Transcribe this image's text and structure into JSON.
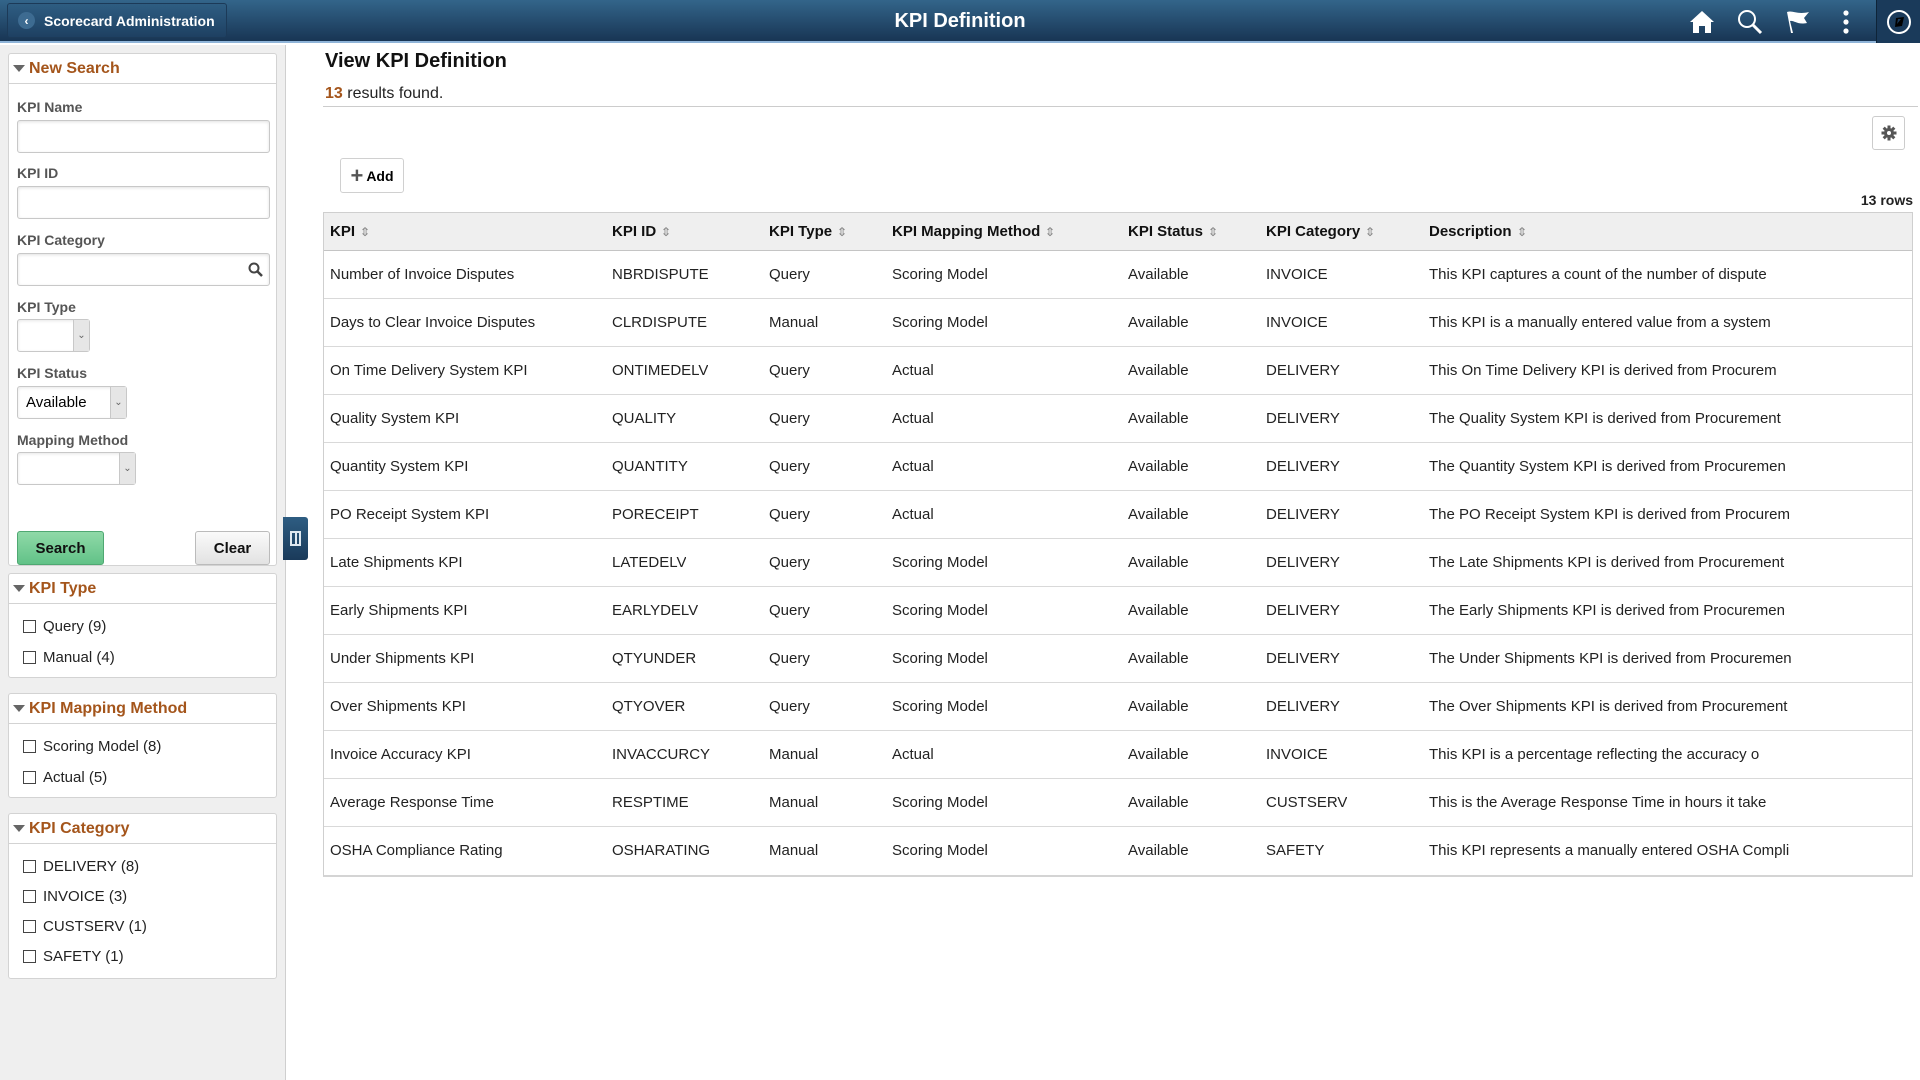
{
  "banner": {
    "back_label": "Scorecard Administration",
    "title": "KPI Definition",
    "icons": [
      "home-icon",
      "search-icon",
      "flag-icon",
      "more-options-icon",
      "navbar-compass-icon"
    ]
  },
  "sidebar": {
    "new_search": {
      "header": "New Search",
      "fields": {
        "kpi_name": {
          "label": "KPI Name",
          "value": ""
        },
        "kpi_id": {
          "label": "KPI ID",
          "value": ""
        },
        "kpi_category": {
          "label": "KPI Category",
          "value": ""
        },
        "kpi_type": {
          "label": "KPI Type",
          "value": ""
        },
        "kpi_status": {
          "label": "KPI Status",
          "value": "Available"
        },
        "mapping_method": {
          "label": "Mapping Method",
          "value": ""
        }
      },
      "search_label": "Search",
      "clear_label": "Clear"
    },
    "facets": [
      {
        "header": "KPI Type",
        "items": [
          {
            "label": "Query (9)"
          },
          {
            "label": "Manual (4)"
          }
        ]
      },
      {
        "header": "KPI Mapping Method",
        "items": [
          {
            "label": "Scoring Model (8)"
          },
          {
            "label": "Actual (5)"
          }
        ]
      },
      {
        "header": "KPI Category",
        "items": [
          {
            "label": "DELIVERY (8)"
          },
          {
            "label": "INVOICE (3)"
          },
          {
            "label": "CUSTSERV (1)"
          },
          {
            "label": "SAFETY (1)"
          }
        ]
      }
    ]
  },
  "main": {
    "title": "View KPI Definition",
    "results_count": "13",
    "results_suffix": " results found.",
    "add_label": "Add",
    "row_count_label": "13 rows",
    "columns": [
      "KPI",
      "KPI ID",
      "KPI Type",
      "KPI Mapping Method",
      "KPI Status",
      "KPI Category",
      "Description"
    ],
    "rows": [
      [
        "Number of Invoice Disputes",
        "NBRDISPUTE",
        "Query",
        "Scoring Model",
        "Available",
        "INVOICE",
        "This KPI captures a count of the number of dispute"
      ],
      [
        "Days to Clear Invoice Disputes",
        "CLRDISPUTE",
        "Manual",
        "Scoring Model",
        "Available",
        "INVOICE",
        "This KPI is a manually entered value from a system"
      ],
      [
        "On Time Delivery System KPI",
        "ONTIMEDELV",
        "Query",
        "Actual",
        "Available",
        "DELIVERY",
        "This On Time Delivery KPI is derived from Procurem"
      ],
      [
        "Quality System KPI",
        "QUALITY",
        "Query",
        "Actual",
        "Available",
        "DELIVERY",
        "The Quality System KPI is derived from Procurement"
      ],
      [
        "Quantity System KPI",
        "QUANTITY",
        "Query",
        "Actual",
        "Available",
        "DELIVERY",
        "The Quantity System KPI is derived from Procuremen"
      ],
      [
        "PO Receipt System KPI",
        "PORECEIPT",
        "Query",
        "Actual",
        "Available",
        "DELIVERY",
        "The PO Receipt System KPI is derived from Procurem"
      ],
      [
        "Late Shipments KPI",
        "LATEDELV",
        "Query",
        "Scoring Model",
        "Available",
        "DELIVERY",
        "The Late Shipments KPI is derived from Procurement"
      ],
      [
        "Early Shipments KPI",
        "EARLYDELV",
        "Query",
        "Scoring Model",
        "Available",
        "DELIVERY",
        "The Early Shipments KPI is derived from Procuremen"
      ],
      [
        "Under Shipments KPI",
        "QTYUNDER",
        "Query",
        "Scoring Model",
        "Available",
        "DELIVERY",
        "The Under Shipments KPI is derived from Procuremen"
      ],
      [
        "Over Shipments KPI",
        "QTYOVER",
        "Query",
        "Scoring Model",
        "Available",
        "DELIVERY",
        "The Over Shipments KPI is derived from Procurement"
      ],
      [
        "Invoice Accuracy KPI",
        "INVACCURCY",
        "Manual",
        "Actual",
        "Available",
        "INVOICE",
        "This KPI is a percentage reflecting the accuracy o"
      ],
      [
        "Average Response Time",
        "RESPTIME",
        "Manual",
        "Scoring Model",
        "Available",
        "CUSTSERV",
        "This is the Average Response Time in hours it take"
      ],
      [
        "OSHA Compliance Rating",
        "OSHARATING",
        "Manual",
        "Scoring Model",
        "Available",
        "SAFETY",
        "This KPI represents a manually entered OSHA Compli"
      ]
    ]
  },
  "colors": {
    "banner_top": "#33658a",
    "banner_bottom": "#183554",
    "accent_orange": "#a4551b",
    "search_green": "#62c288"
  }
}
